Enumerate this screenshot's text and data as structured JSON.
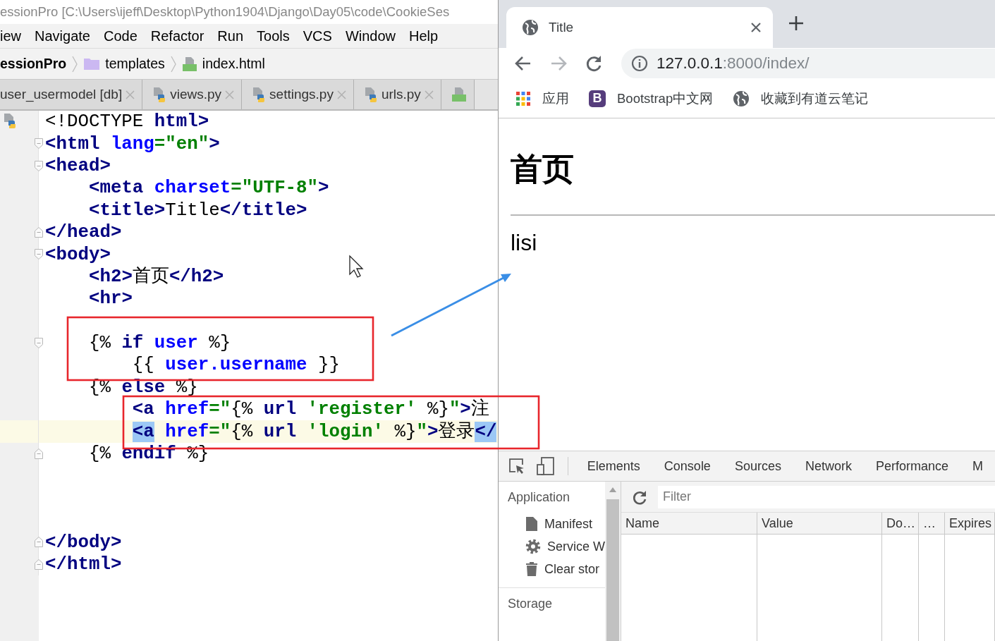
{
  "ide": {
    "title": "essionPro [C:\\Users\\ijeff\\Desktop\\Python1904\\Django\\Day05\\code\\CookieSes",
    "menu": [
      "iew",
      "Navigate",
      "Code",
      "Refactor",
      "Run",
      "Tools",
      "VCS",
      "Window",
      "Help"
    ],
    "breadcrumb": [
      {
        "kind": "project",
        "label": "essionPro"
      },
      {
        "kind": "folder",
        "label": "templates"
      },
      {
        "kind": "html",
        "label": "index.html"
      }
    ],
    "tabs": [
      {
        "kind": "db",
        "label": "user_usermodel [db]",
        "selected": false
      },
      {
        "kind": "python",
        "label": "views.py",
        "selected": false
      },
      {
        "kind": "python",
        "label": "settings.py",
        "selected": false
      },
      {
        "kind": "python",
        "label": "urls.py",
        "selected": false
      },
      {
        "kind": "html",
        "selected": false
      }
    ],
    "code": [
      {
        "kind": "plain",
        "current": false,
        "tokens": [
          {
            "kind": "plain",
            "text": "<!DOCTYPE "
          },
          {
            "kind": "tag",
            "text": "html"
          },
          {
            "kind": "tag",
            "text": ">"
          }
        ]
      },
      {
        "kind": "open",
        "current": false,
        "tokens": [
          {
            "kind": "tag",
            "text": "<html "
          },
          {
            "kind": "attr",
            "text": "lang"
          },
          {
            "kind": "value",
            "text": "=\"en\""
          },
          {
            "kind": "tag",
            "text": ">"
          }
        ]
      },
      {
        "kind": "open",
        "current": false,
        "tokens": [
          {
            "kind": "tag",
            "text": "<head>"
          }
        ]
      },
      {
        "kind": "plain",
        "current": false,
        "tokens": [
          {
            "kind": "tag",
            "text": "    <meta "
          },
          {
            "kind": "attr",
            "text": "charset"
          },
          {
            "kind": "value",
            "text": "=\"UTF-8\""
          },
          {
            "kind": "tag",
            "text": ">"
          }
        ]
      },
      {
        "kind": "plain",
        "current": false,
        "tokens": [
          {
            "kind": "tag",
            "text": "    <title>"
          },
          {
            "kind": "plain",
            "text": "Title"
          },
          {
            "kind": "tag",
            "text": "</title>"
          }
        ]
      },
      {
        "kind": "close",
        "current": false,
        "tokens": [
          {
            "kind": "tag",
            "text": "</head>"
          }
        ]
      },
      {
        "kind": "open",
        "current": false,
        "tokens": [
          {
            "kind": "tag",
            "text": "<body>"
          }
        ]
      },
      {
        "kind": "plain",
        "current": false,
        "tokens": [
          {
            "kind": "tag",
            "text": "    <h2>"
          },
          {
            "kind": "plain",
            "text": "首页"
          },
          {
            "kind": "tag",
            "text": "</h2>"
          }
        ]
      },
      {
        "kind": "plain",
        "current": false,
        "tokens": [
          {
            "kind": "tag",
            "text": "    <hr>"
          }
        ]
      },
      {
        "kind": "plain",
        "current": false
      },
      {
        "kind": "open",
        "current": false,
        "tokens": [
          {
            "kind": "plain",
            "text": "    {% "
          },
          {
            "kind": "keyword",
            "text": "if "
          },
          {
            "kind": "var",
            "text": "user"
          },
          {
            "kind": "plain",
            "text": " %}"
          }
        ]
      },
      {
        "kind": "plain",
        "current": false,
        "tokens": [
          {
            "kind": "plain",
            "text": "        {{ "
          },
          {
            "kind": "var",
            "text": "user.username"
          },
          {
            "kind": "plain",
            "text": " }}"
          }
        ]
      },
      {
        "kind": "plain",
        "current": false,
        "tokens": [
          {
            "kind": "plain",
            "text": "    {% "
          },
          {
            "kind": "keyword",
            "text": "else"
          },
          {
            "kind": "plain",
            "text": " %}"
          }
        ]
      },
      {
        "kind": "plain",
        "current": false,
        "tokens": [
          {
            "kind": "tag",
            "text": "        <a "
          },
          {
            "kind": "attr",
            "text": "href"
          },
          {
            "kind": "value",
            "text": "=\""
          },
          {
            "kind": "plain",
            "text": "{% "
          },
          {
            "kind": "keyword",
            "text": "url "
          },
          {
            "kind": "value",
            "text": "'register'"
          },
          {
            "kind": "plain",
            "text": " %}"
          },
          {
            "kind": "value",
            "text": "\""
          },
          {
            "kind": "tag",
            "text": ">"
          },
          {
            "kind": "plain",
            "text": "注"
          }
        ]
      },
      {
        "kind": "plain",
        "current": true,
        "tokens": [
          {
            "kind": "match",
            "text": "        <a"
          },
          {
            "kind": "attr",
            "text": " href"
          },
          {
            "kind": "value",
            "text": "=\""
          },
          {
            "kind": "plain",
            "text": "{% "
          },
          {
            "kind": "keyword",
            "text": "url "
          },
          {
            "kind": "value",
            "text": "'login'"
          },
          {
            "kind": "plain",
            "text": " %}"
          },
          {
            "kind": "value",
            "text": "\""
          },
          {
            "kind": "tag",
            "text": ">"
          },
          {
            "kind": "plain",
            "text": "登录"
          },
          {
            "kind": "match",
            "text": "</"
          }
        ]
      },
      {
        "kind": "close",
        "current": false,
        "tokens": [
          {
            "kind": "plain",
            "text": "    {% "
          },
          {
            "kind": "keyword",
            "text": "endif"
          },
          {
            "kind": "plain",
            "text": " %}"
          }
        ]
      },
      {
        "kind": "plain",
        "current": false
      },
      {
        "kind": "plain",
        "current": false
      },
      {
        "kind": "plain",
        "current": false
      },
      {
        "kind": "close",
        "current": false,
        "tokens": [
          {
            "kind": "tag",
            "text": "</body>"
          }
        ]
      },
      {
        "kind": "close",
        "current": false,
        "tokens": [
          {
            "kind": "tag",
            "text": "</html>"
          }
        ]
      }
    ]
  },
  "browser": {
    "tabs": [
      {
        "title": "Title",
        "selected": true
      }
    ],
    "nav": [
      {
        "kind": "back",
        "disabled": false
      },
      {
        "kind": "forward",
        "disabled": true
      },
      {
        "kind": "reload",
        "disabled": false
      }
    ],
    "url_host": "127.0.0.1",
    "url_path": ":8000/index/",
    "bookmarks": [
      {
        "kind": "apps",
        "label": "应用"
      },
      {
        "kind": "letter",
        "logo": "B",
        "label": "Bootstrap中文网"
      },
      {
        "kind": "globe",
        "label": "收藏到有道云笔记"
      }
    ],
    "page": {
      "heading": "首页",
      "text": "lisi"
    },
    "devtools": {
      "tabs": [
        {
          "label": "Elements",
          "selected": false
        },
        {
          "label": "Console",
          "selected": false
        },
        {
          "label": "Sources",
          "selected": false
        },
        {
          "label": "Network",
          "selected": false
        },
        {
          "label": "Performance",
          "selected": false
        },
        {
          "label": "M",
          "selected": false
        }
      ],
      "sidebar": [
        {
          "kind": "heading",
          "label": "Application"
        },
        {
          "kind": "item",
          "label": "Manifest"
        },
        {
          "kind": "item",
          "label": "Service W"
        },
        {
          "kind": "item",
          "label": "Clear stor"
        },
        {
          "kind": "heading",
          "label": "Storage"
        }
      ],
      "filter": {
        "placeholder": "Filter"
      },
      "columns": [
        "Name",
        "Value",
        "Do…",
        "…",
        "Expires"
      ]
    }
  }
}
